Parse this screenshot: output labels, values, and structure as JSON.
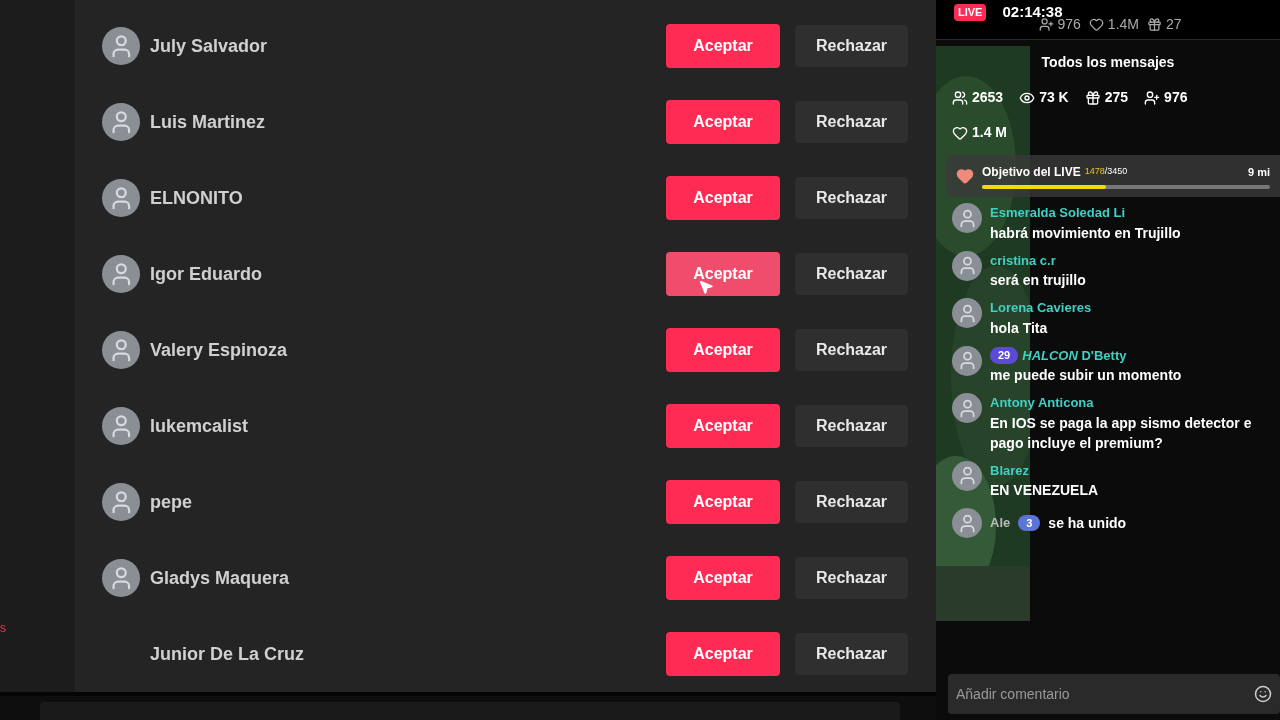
{
  "side_strip": {
    "label": "s"
  },
  "requests": [
    {
      "name": "July Salvador",
      "avatar": true,
      "hovered": false,
      "accept": "Aceptar",
      "reject": "Rechazar"
    },
    {
      "name": "Luis Martinez",
      "avatar": true,
      "hovered": false,
      "accept": "Aceptar",
      "reject": "Rechazar"
    },
    {
      "name": "ELNONITO",
      "avatar": true,
      "hovered": false,
      "accept": "Aceptar",
      "reject": "Rechazar"
    },
    {
      "name": "Igor Eduardo",
      "avatar": true,
      "hovered": true,
      "accept": "Aceptar",
      "reject": "Rechazar"
    },
    {
      "name": "Valery Espinoza",
      "avatar": true,
      "hovered": false,
      "accept": "Aceptar",
      "reject": "Rechazar"
    },
    {
      "name": "lukemcalist",
      "avatar": true,
      "hovered": false,
      "accept": "Aceptar",
      "reject": "Rechazar"
    },
    {
      "name": "pepe",
      "avatar": true,
      "hovered": false,
      "accept": "Aceptar",
      "reject": "Rechazar"
    },
    {
      "name": "Gladys Maquera",
      "avatar": true,
      "hovered": false,
      "accept": "Aceptar",
      "reject": "Rechazar"
    },
    {
      "name": "Junior De La Cruz",
      "avatar": false,
      "hovered": false,
      "accept": "Aceptar",
      "reject": "Rechazar"
    }
  ],
  "live": {
    "badge": "LIVE",
    "timer": "02:14:38",
    "header_stats": [
      {
        "kind": "follow",
        "value": "976"
      },
      {
        "kind": "like",
        "value": "1.4M"
      },
      {
        "kind": "gift",
        "value": "27"
      }
    ],
    "chat_title": "Todos los mensajes",
    "stats": [
      {
        "kind": "viewers",
        "value": "2653"
      },
      {
        "kind": "views",
        "value": "73 K"
      },
      {
        "kind": "gift",
        "value": "275"
      },
      {
        "kind": "follow",
        "value": "976"
      },
      {
        "kind": "like",
        "value": "1.4 M"
      }
    ],
    "goal": {
      "label": "Objetivo del LIVE",
      "current": "1478",
      "total": "/3450",
      "time": "9 mi",
      "level": 0.43
    },
    "messages": [
      {
        "kind": "comment",
        "user": "Esmeralda Soledad Li",
        "text": "habrá movimiento en Trujillo"
      },
      {
        "kind": "comment",
        "user": "cristina c.r",
        "text": "será en trujillo"
      },
      {
        "kind": "comment",
        "user": "Lorena Cavieres",
        "text": "hola Tita"
      },
      {
        "kind": "comment",
        "badge": "29",
        "user": "*HALCON* D'Betty",
        "text": "me puede subir un momento"
      },
      {
        "kind": "comment",
        "user": "Antony Anticona",
        "text": "En IOS se paga la app sismo detector e pago incluye el premium?"
      },
      {
        "kind": "comment",
        "user": "Blarez",
        "text": "EN VENEZUELA"
      },
      {
        "kind": "join",
        "user": "Ale",
        "badge": "3",
        "text": "se ha unido"
      }
    ],
    "comment_field": {
      "placeholder": "Añadir comentario"
    }
  }
}
